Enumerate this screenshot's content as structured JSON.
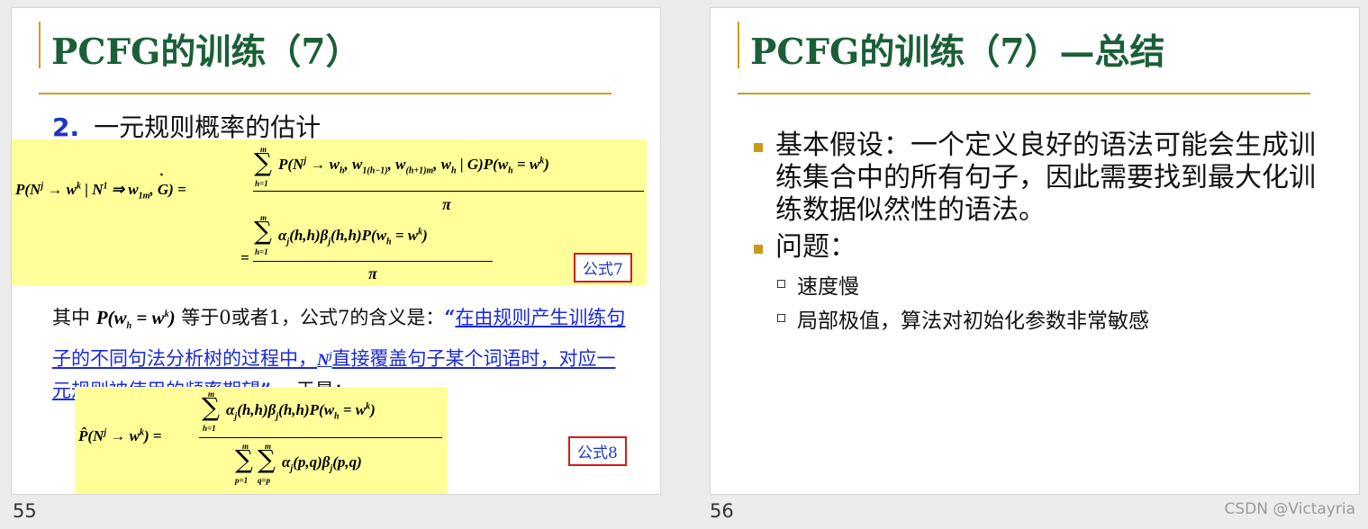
{
  "slides": [
    {
      "number": "55",
      "title": "PCFG的训练（7）",
      "section_num": "2.",
      "section_title": "一元规则概率的估计",
      "formula7_label": "公式7",
      "formula8_label": "公式8",
      "para_prefix": "其中",
      "para_mid": "等于0或者1，公式7的含义是：",
      "para_quote_open": "“",
      "para_link1": "在由规则产生训练句子的不同句法分析树的过程中，",
      "para_link2": "直接覆盖句子某个词语时，对应一元规则被使用的频率期望",
      "para_quote_close": "”，",
      "para_suffix": "于是："
    },
    {
      "number": "56",
      "title": "PCFG的训练（7）—总结",
      "bullets": [
        {
          "text": "基本假设：一个定义良好的语法可能会生成训练集合中的所有句子，因此需要找到最大化训练数据似然性的语法。"
        },
        {
          "text": "问题："
        }
      ],
      "sub_bullets": [
        "速度慢",
        "局部极值，算法对初始化参数非常敏感"
      ]
    }
  ],
  "watermark": "CSDN @Victayria",
  "colors": {
    "title": "#1a5f36",
    "accent_rule": "#c8a020",
    "highlight": "#ffff99",
    "link": "#1a2ad8",
    "label_border": "#d21c1c"
  }
}
